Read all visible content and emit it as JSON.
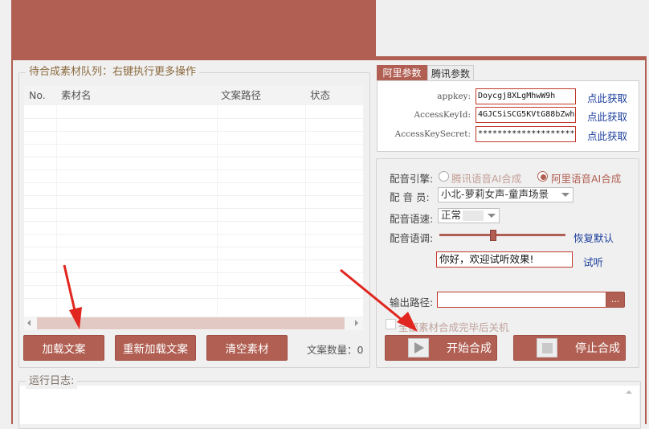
{
  "queue": {
    "title": "待合成素材队列：右键执行更多操作",
    "columns": [
      "No.",
      "素材名",
      "文案路径",
      "状态"
    ],
    "buttons": {
      "load": "加载文案",
      "reload": "重新加载文案",
      "clear": "清空素材"
    },
    "count_label": "文案数量：0"
  },
  "tabs": {
    "ali": "阿里参数",
    "tencent": "腾讯参数"
  },
  "keys": {
    "appkey_label": "appkey:",
    "appkey_value": "Doycgj8XLgMhwW9h",
    "access_id_label": "AccessKeyId:",
    "access_id_value": "4GJCSiSCG5KVtG88bZwh",
    "secret_label": "AccessKeySecret:",
    "secret_value": "********************",
    "get_link": "点此获取"
  },
  "voice": {
    "engine_label": "配音引擎:",
    "engine_tencent": "腾讯语音AI合成",
    "engine_ali": "阿里语音AI合成",
    "speaker_label": "配 音 员:",
    "speaker_value": "小北-萝莉女声-童声场景",
    "speed_label": "配音语速:",
    "speed_value": "正常",
    "pitch_label": "配音语调:",
    "pitch_level": 0.45,
    "restore_default": "恢复默认",
    "test_text": "你好，欢迎试听效果!",
    "test_link": "试听"
  },
  "output": {
    "path_label": "输出路径:",
    "path_value": "",
    "browse": "...",
    "shutdown_label": "全部素材合成完毕后关机",
    "start": "开始合成",
    "stop": "停止合成"
  },
  "log": {
    "title": "运行日志:"
  },
  "colors": {
    "accent": "#b05f52",
    "link": "#1a3d9c",
    "arrow": "#e0261e"
  }
}
